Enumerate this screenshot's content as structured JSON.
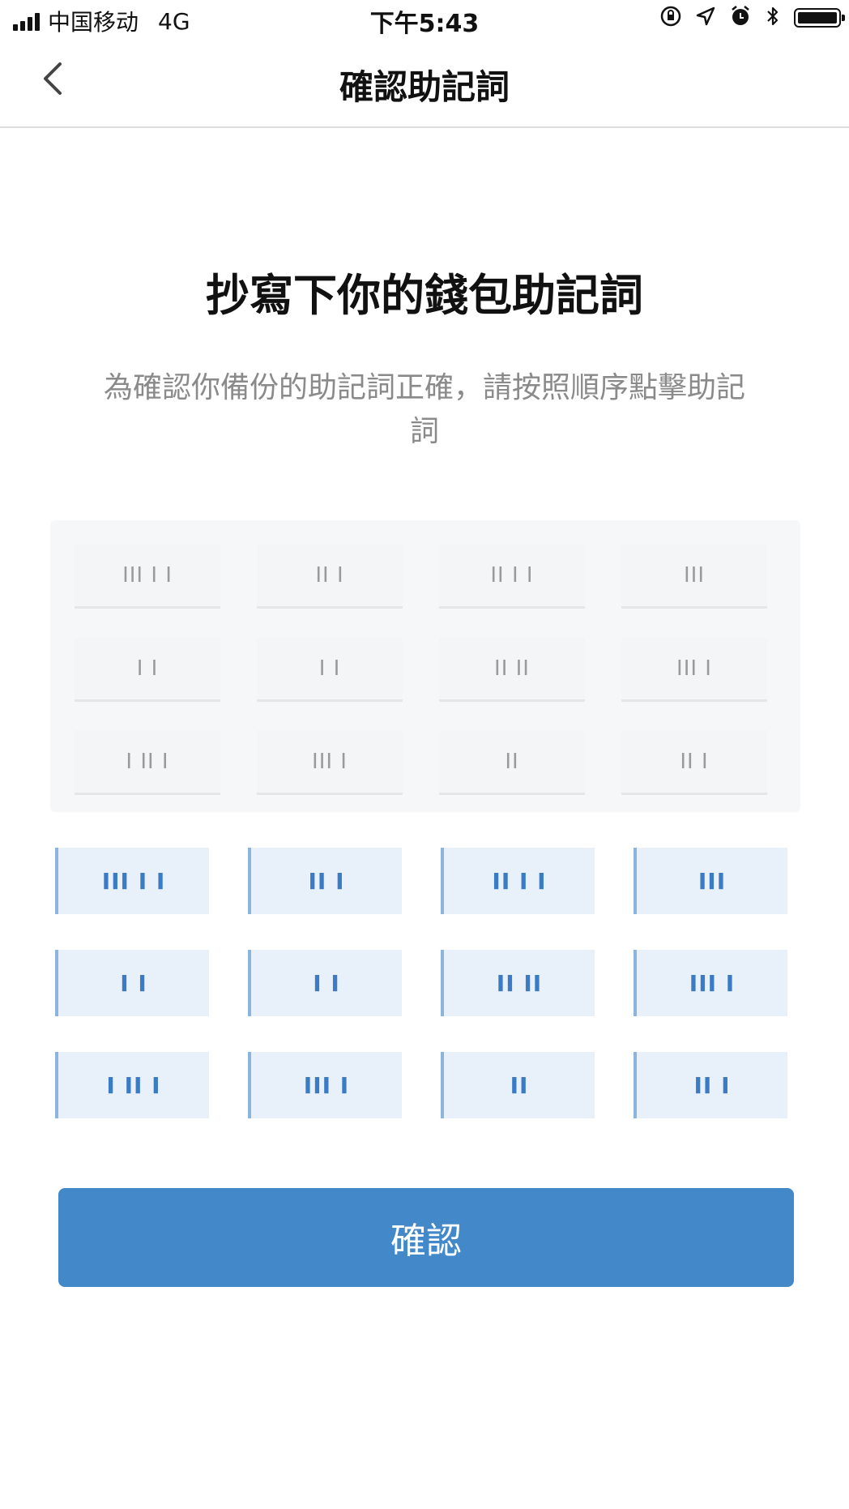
{
  "status_bar": {
    "carrier": "中国移动",
    "network": "4G",
    "time": "下午5:43"
  },
  "nav": {
    "title": "確認助記詞",
    "back_icon": "chevron-left-icon"
  },
  "main": {
    "headline": "抄寫下你的錢包助記詞",
    "instruction": "為確認你備份的助記詞正確，請按照順序點擊助記詞"
  },
  "answer_slots": [
    {
      "label": "III I I"
    },
    {
      "label": "II I"
    },
    {
      "label": "II I I"
    },
    {
      "label": "III"
    },
    {
      "label": "I I"
    },
    {
      "label": "I I"
    },
    {
      "label": "II II"
    },
    {
      "label": "III I"
    },
    {
      "label": "I II I"
    },
    {
      "label": "III I"
    },
    {
      "label": "II"
    },
    {
      "label": "II I"
    }
  ],
  "word_tiles": [
    {
      "label": "III I I"
    },
    {
      "label": "II I"
    },
    {
      "label": "II I I"
    },
    {
      "label": "III"
    },
    {
      "label": "I I"
    },
    {
      "label": "I I"
    },
    {
      "label": "II II"
    },
    {
      "label": "III I"
    },
    {
      "label": "I II I"
    },
    {
      "label": "III I"
    },
    {
      "label": "II"
    },
    {
      "label": "II I"
    }
  ],
  "confirm_button": {
    "label": "確認",
    "color": "#4388c8"
  },
  "colors": {
    "tile_bg": "#e8f1fa",
    "tile_text": "#3b7bc4",
    "answer_bg": "#f6f7f9"
  }
}
